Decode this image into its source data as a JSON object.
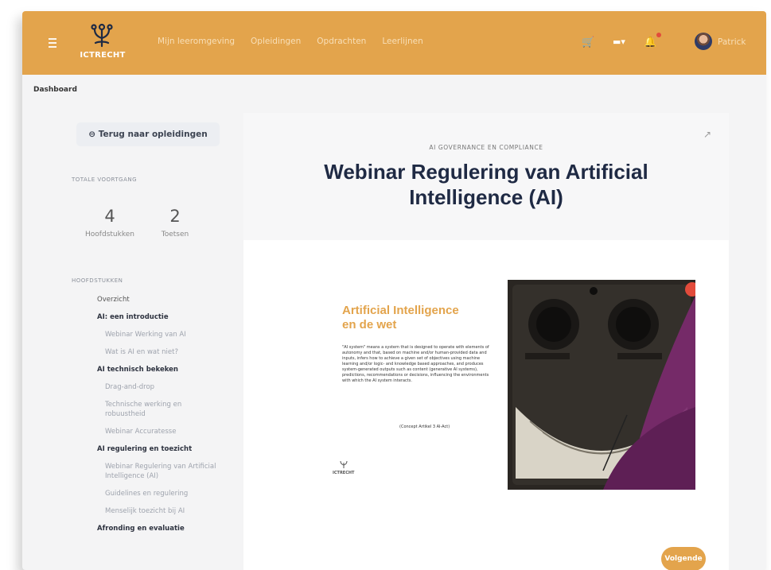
{
  "header": {
    "logo_text": "ICTRECHT",
    "nav": [
      "Mijn leeromgeving",
      "Opleidingen",
      "Opdrachten",
      "Leerlijnen"
    ],
    "user_name": "Patrick",
    "icons": [
      "menu-icon",
      "cart-icon",
      "language-icon",
      "bell-icon",
      "avatar"
    ]
  },
  "breadcrumb": "Dashboard",
  "sidebar": {
    "back_label": "Terug naar opleidingen",
    "progress_caption": "TOTALE VOORTGANG",
    "stats": [
      {
        "value": "4",
        "label": "Hoofdstukken"
      },
      {
        "value": "2",
        "label": "Toetsen"
      }
    ],
    "chapters_caption": "HOOFDSTUKKEN",
    "chapters": [
      {
        "label": "Overzicht",
        "kind": "first"
      },
      {
        "label": "AI: een introductie",
        "kind": "main"
      },
      {
        "label": "Webinar Werking van AI",
        "kind": "sub"
      },
      {
        "label": "Wat is AI en wat niet?",
        "kind": "sub"
      },
      {
        "label": "AI technisch bekeken",
        "kind": "main"
      },
      {
        "label": "Drag-and-drop",
        "kind": "sub"
      },
      {
        "label": "Technische werking en robuustheid",
        "kind": "sub"
      },
      {
        "label": "Webinar Accuratesse",
        "kind": "sub"
      },
      {
        "label": "AI regulering en toezicht",
        "kind": "main"
      },
      {
        "label": "Webinar Regulering van Artificial Intelligence (AI)",
        "kind": "sub"
      },
      {
        "label": "Guidelines en regulering",
        "kind": "sub"
      },
      {
        "label": "Menselijk toezicht bij AI",
        "kind": "sub"
      },
      {
        "label": "Afronding en evaluatie",
        "kind": "main"
      }
    ]
  },
  "content": {
    "kicker": "AI GOVERNANCE EN COMPLIANCE",
    "title": "Webinar Regulering van Artificial Intelligence (AI)",
    "slide": {
      "title_line1": "Artificial Intelligence",
      "title_line2": "en de wet",
      "body": "\"AI system\" means a system that is designed to operate with elements of autonomy and that, based on machine and/or human-provided data and inputs, infers how to achieve a given set of objectives using machine learning and/or logic- and knowledge based approaches, and produces system-generated outputs such as content (generative AI systems), predictions, recommendations or decisions, influencing the environments with which the AI system interacts.",
      "source": "(Concept Artikel 3 AI-Act)",
      "logo_text": "ICTRECHT"
    },
    "next_label": "Volgende"
  },
  "colors": {
    "accent": "#e3a44c",
    "title": "#1f2a44",
    "purple": "#7b2a6e"
  }
}
